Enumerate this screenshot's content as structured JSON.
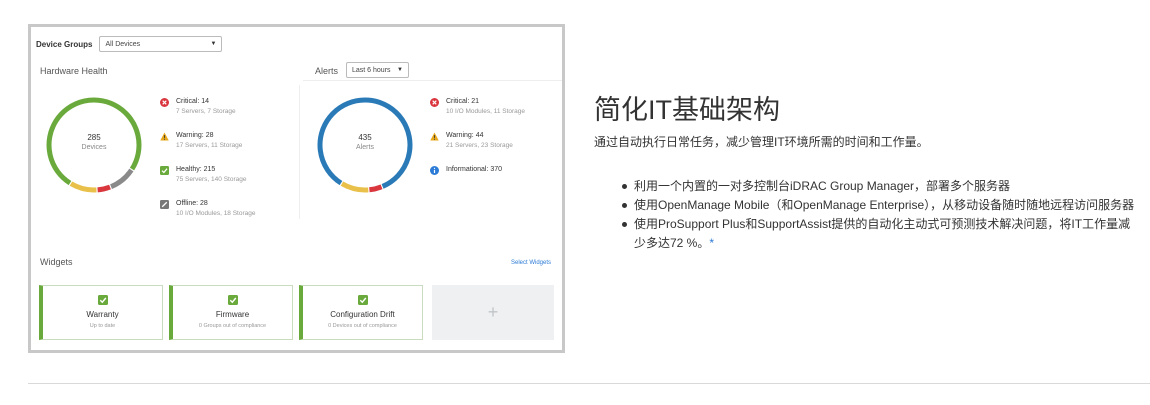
{
  "dashboard": {
    "device_groups_label": "Device Groups",
    "device_groups_value": "All Devices",
    "hardware_health": {
      "title": "Hardware Health",
      "total": "285",
      "total_label": "Devices",
      "legend": [
        {
          "title": "Critical: 14",
          "sub": "7 Servers, 7 Storage",
          "icon": "critical-icon",
          "color": "#d9363e"
        },
        {
          "title": "Warning: 28",
          "sub": "17 Servers, 11 Storage",
          "icon": "warning-icon",
          "color": "#e8a81b"
        },
        {
          "title": "Healthy: 215",
          "sub": "75 Servers, 140 Storage",
          "icon": "healthy-icon",
          "color": "#6aaa3c"
        },
        {
          "title": "Offline: 28",
          "sub": "10 I/O Modules, 18 Storage",
          "icon": "offline-icon",
          "color": "#777777"
        }
      ],
      "ring": [
        {
          "name": "healthy",
          "value": 215,
          "color": "#6aaa3c"
        },
        {
          "name": "offline",
          "value": 28,
          "color": "#8a8a8a"
        },
        {
          "name": "critical",
          "value": 14,
          "color": "#d9363e"
        },
        {
          "name": "warning",
          "value": 28,
          "color": "#e8c04a"
        }
      ]
    },
    "alerts": {
      "title": "Alerts",
      "range_value": "Last 6 hours",
      "total": "435",
      "total_label": "Alerts",
      "legend": [
        {
          "title": "Critical: 21",
          "sub": "10 I/O Modules, 11 Storage",
          "icon": "critical-icon",
          "color": "#d9363e"
        },
        {
          "title": "Warning: 44",
          "sub": "21 Servers, 23 Storage",
          "icon": "warning-icon",
          "color": "#e8a81b"
        },
        {
          "title": "Informational: 370",
          "sub": "",
          "icon": "info-icon",
          "color": "#2c7bd6"
        }
      ],
      "ring": [
        {
          "name": "informational",
          "value": 370,
          "color": "#2a7ab8"
        },
        {
          "name": "critical",
          "value": 21,
          "color": "#d9363e"
        },
        {
          "name": "warning",
          "value": 44,
          "color": "#e8c04a"
        }
      ]
    },
    "widgets": {
      "title": "Widgets",
      "select_link": "Select Widgets",
      "tiles": [
        {
          "title": "Warranty",
          "sub": "Up to date"
        },
        {
          "title": "Firmware",
          "sub": "0 Groups out of compliance"
        },
        {
          "title": "Configuration Drift",
          "sub": "0 Devices out of compliance"
        }
      ],
      "add_symbol": "+"
    }
  },
  "content": {
    "heading": "简化IT基础架构",
    "intro": "通过自动执行日常任务，减少管理IT环境所需的时间和工作量。",
    "bullets": [
      "利用一个内置的一对多控制台iDRAC Group Manager，部署多个服务器",
      "使用OpenManage Mobile（和OpenManage Enterprise），从移动设备随时随地远程访问服务器",
      "使用ProSupport Plus和SupportAssist提供的自动化主动式可预测技术解决问题，将IT工作量减少多达72 %。"
    ],
    "footnote_mark": "*"
  }
}
